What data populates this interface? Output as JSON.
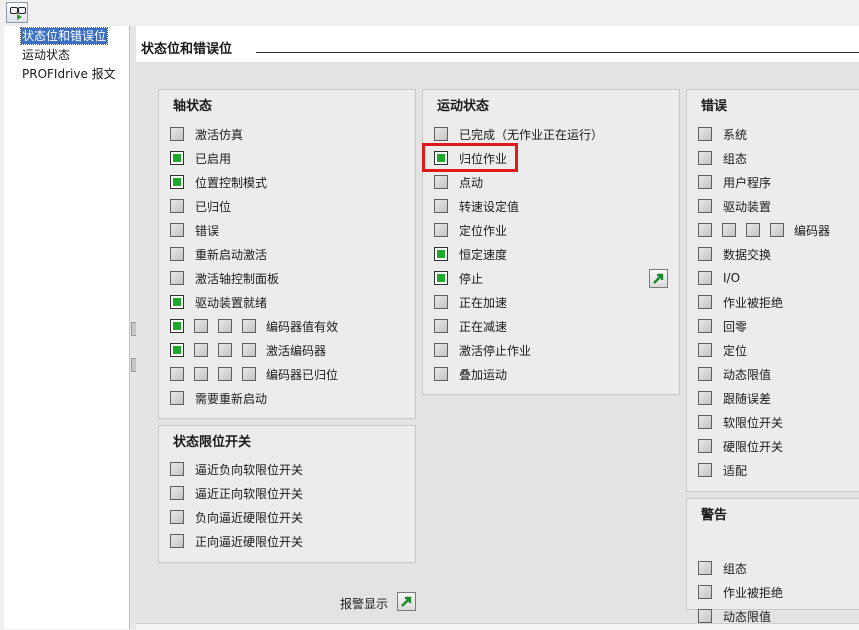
{
  "tree": {
    "items": [
      "状态位和错误位",
      "运动状态",
      "PROFIdrive 报文"
    ]
  },
  "page": {
    "title": "状态位和错误位"
  },
  "axis_status": {
    "title": "轴状态",
    "items": [
      {
        "label": "激活仿真",
        "checked": false
      },
      {
        "label": "已启用",
        "checked": true
      },
      {
        "label": "位置控制模式",
        "checked": true
      },
      {
        "label": "已归位",
        "checked": false
      },
      {
        "label": "错误",
        "checked": false
      },
      {
        "label": "重新启动激活",
        "checked": false
      },
      {
        "label": "激活轴控制面板",
        "checked": false
      },
      {
        "label": "驱动装置就绪",
        "checked": true
      },
      {
        "label": "编码器值有效",
        "checked": [
          true,
          false,
          false,
          false
        ]
      },
      {
        "label": "激活编码器",
        "checked": [
          true,
          false,
          false,
          false
        ]
      },
      {
        "label": "编码器已归位",
        "checked": [
          false,
          false,
          false,
          false
        ]
      },
      {
        "label": "需要重新启动",
        "checked": false
      }
    ]
  },
  "limit_status": {
    "title": "状态限位开关",
    "items": [
      {
        "label": "逼近负向软限位开关",
        "checked": false
      },
      {
        "label": "逼近正向软限位开关",
        "checked": false
      },
      {
        "label": "负向逼近硬限位开关",
        "checked": false
      },
      {
        "label": "正向逼近硬限位开关",
        "checked": false
      }
    ]
  },
  "motion_status": {
    "title": "运动状态",
    "items": [
      {
        "label": "已完成（无作业正在运行）",
        "checked": false
      },
      {
        "label": "归位作业",
        "checked": true
      },
      {
        "label": "点动",
        "checked": false
      },
      {
        "label": "转速设定值",
        "checked": false
      },
      {
        "label": "定位作业",
        "checked": false
      },
      {
        "label": "恒定速度",
        "checked": true
      },
      {
        "label": "停止",
        "checked": true
      },
      {
        "label": "正在加速",
        "checked": false
      },
      {
        "label": "正在减速",
        "checked": false
      },
      {
        "label": "激活停止作业",
        "checked": false
      },
      {
        "label": "叠加运动",
        "checked": false
      }
    ]
  },
  "errors": {
    "title": "错误",
    "items": [
      {
        "label": "系统",
        "checked": false
      },
      {
        "label": "组态",
        "checked": false
      },
      {
        "label": "用户程序",
        "checked": false
      },
      {
        "label": "驱动装置",
        "checked": false
      },
      {
        "label": "编码器",
        "checked": [
          false,
          false,
          false,
          false
        ]
      },
      {
        "label": "数据交换",
        "checked": false
      },
      {
        "label": "I/O",
        "checked": false
      },
      {
        "label": "作业被拒绝",
        "checked": false
      },
      {
        "label": "回零",
        "checked": false
      },
      {
        "label": "定位",
        "checked": false
      },
      {
        "label": "动态限值",
        "checked": false
      },
      {
        "label": "跟随误差",
        "checked": false
      },
      {
        "label": "软限位开关",
        "checked": false
      },
      {
        "label": "硬限位开关",
        "checked": false
      },
      {
        "label": "适配",
        "checked": false
      }
    ]
  },
  "warnings": {
    "title": "警告",
    "items": [
      {
        "label": "组态",
        "checked": false
      },
      {
        "label": "作业被拒绝",
        "checked": false
      },
      {
        "label": "动态限值",
        "checked": false
      }
    ]
  },
  "alarm_display": {
    "label": "报警显示"
  },
  "colors": {
    "checked_fill": "#1fa82f",
    "highlight": "#e01a1a",
    "selection": "#3a6fc2"
  }
}
